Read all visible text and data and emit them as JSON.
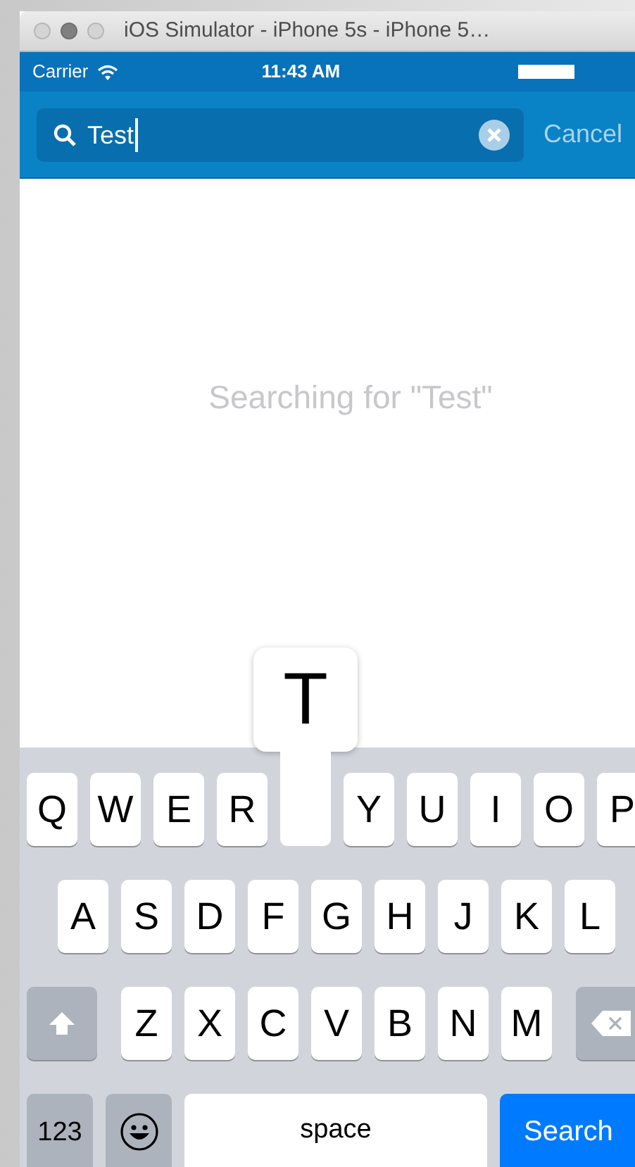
{
  "window": {
    "title": "iOS Simulator - iPhone 5s - iPhone 5…"
  },
  "status_bar": {
    "carrier": "Carrier",
    "time": "11:43 AM"
  },
  "search": {
    "value": "Test",
    "cancel": "Cancel"
  },
  "content": {
    "message": "Searching for \"Test\""
  },
  "keyboard": {
    "rows": [
      [
        {
          "kind": "letter",
          "label": "Q",
          "pressed": false
        },
        {
          "kind": "letter",
          "label": "W",
          "pressed": false
        },
        {
          "kind": "letter",
          "label": "E",
          "pressed": false
        },
        {
          "kind": "letter",
          "label": "R",
          "pressed": false
        },
        {
          "kind": "letter",
          "label": "T",
          "pressed": true
        },
        {
          "kind": "letter",
          "label": "Y",
          "pressed": false
        },
        {
          "kind": "letter",
          "label": "U",
          "pressed": false
        },
        {
          "kind": "letter",
          "label": "I",
          "pressed": false
        },
        {
          "kind": "letter",
          "label": "O",
          "pressed": false
        },
        {
          "kind": "letter",
          "label": "P",
          "pressed": false
        }
      ],
      [
        {
          "kind": "letter",
          "label": "A",
          "pressed": false
        },
        {
          "kind": "letter",
          "label": "S",
          "pressed": false
        },
        {
          "kind": "letter",
          "label": "D",
          "pressed": false
        },
        {
          "kind": "letter",
          "label": "F",
          "pressed": false
        },
        {
          "kind": "letter",
          "label": "G",
          "pressed": false
        },
        {
          "kind": "letter",
          "label": "H",
          "pressed": false
        },
        {
          "kind": "letter",
          "label": "J",
          "pressed": false
        },
        {
          "kind": "letter",
          "label": "K",
          "pressed": false
        },
        {
          "kind": "letter",
          "label": "L",
          "pressed": false
        }
      ],
      [
        {
          "kind": "shift"
        },
        {
          "kind": "letter",
          "label": "Z",
          "pressed": false
        },
        {
          "kind": "letter",
          "label": "X",
          "pressed": false
        },
        {
          "kind": "letter",
          "label": "C",
          "pressed": false
        },
        {
          "kind": "letter",
          "label": "V",
          "pressed": false
        },
        {
          "kind": "letter",
          "label": "B",
          "pressed": false
        },
        {
          "kind": "letter",
          "label": "N",
          "pressed": false
        },
        {
          "kind": "letter",
          "label": "M",
          "pressed": false
        },
        {
          "kind": "delete"
        }
      ]
    ],
    "bottom_row": [
      {
        "kind": "numbers",
        "label": "123"
      },
      {
        "kind": "emoji"
      },
      {
        "kind": "space",
        "label": "space"
      },
      {
        "kind": "search",
        "label": "Search"
      }
    ]
  }
}
